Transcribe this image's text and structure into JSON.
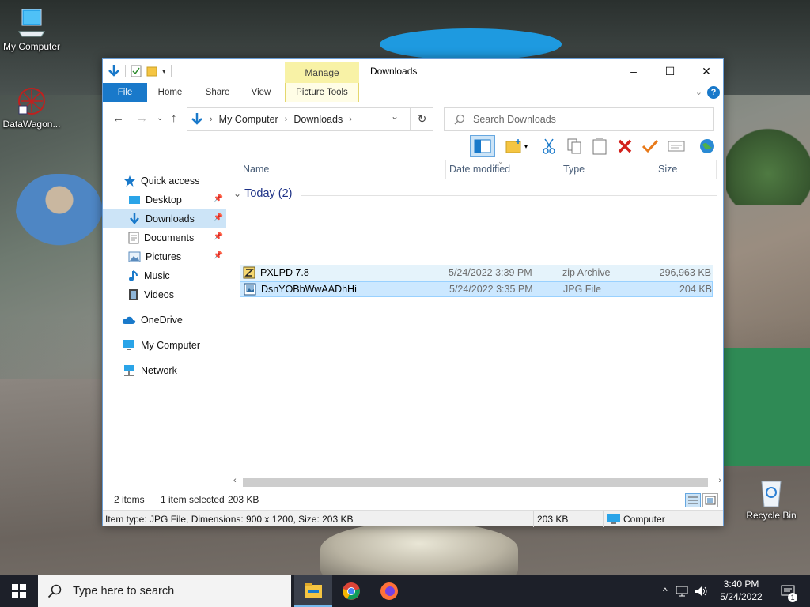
{
  "desktop": {
    "icons": [
      {
        "label": "My Computer"
      },
      {
        "label": "DataWagon..."
      },
      {
        "label": "Recycle Bin"
      }
    ]
  },
  "window": {
    "title": "Downloads",
    "manage_label": "Manage",
    "tabs": {
      "file": "File",
      "home": "Home",
      "share": "Share",
      "view": "View",
      "picture_tools": "Picture Tools"
    },
    "address": {
      "root": "My Computer",
      "folder": "Downloads"
    },
    "search_placeholder": "Search Downloads",
    "nav": {
      "quick_access": "Quick access",
      "desktop": "Desktop",
      "downloads": "Downloads",
      "documents": "Documents",
      "pictures": "Pictures",
      "music": "Music",
      "videos": "Videos",
      "onedrive": "OneDrive",
      "my_computer": "My Computer",
      "network": "Network"
    },
    "columns": {
      "name": "Name",
      "date": "Date modified",
      "type": "Type",
      "size": "Size"
    },
    "group": {
      "label": "Today (2)"
    },
    "files": [
      {
        "name": "PXLPD 7.8",
        "date": "5/24/2022 3:39 PM",
        "type": "zip Archive",
        "size": "296,963 KB"
      },
      {
        "name": "DsnYOBbWwAADhHi",
        "date": "5/24/2022 3:35 PM",
        "type": "JPG File",
        "size": "204 KB"
      }
    ],
    "status": {
      "items": "2 items",
      "selected": "1 item selected",
      "size": "203 KB"
    },
    "details": {
      "info": "Item type: JPG File, Dimensions: 900 x 1200, Size: 203 KB",
      "size": "203 KB",
      "location": "Computer"
    }
  },
  "taskbar": {
    "search_placeholder": "Type here to search",
    "time": "3:40 PM",
    "date": "5/24/2022",
    "notifications": "1"
  },
  "colors": {
    "accent": "#1979ca",
    "selection": "#cce8ff",
    "manage": "#f8f2a6"
  }
}
